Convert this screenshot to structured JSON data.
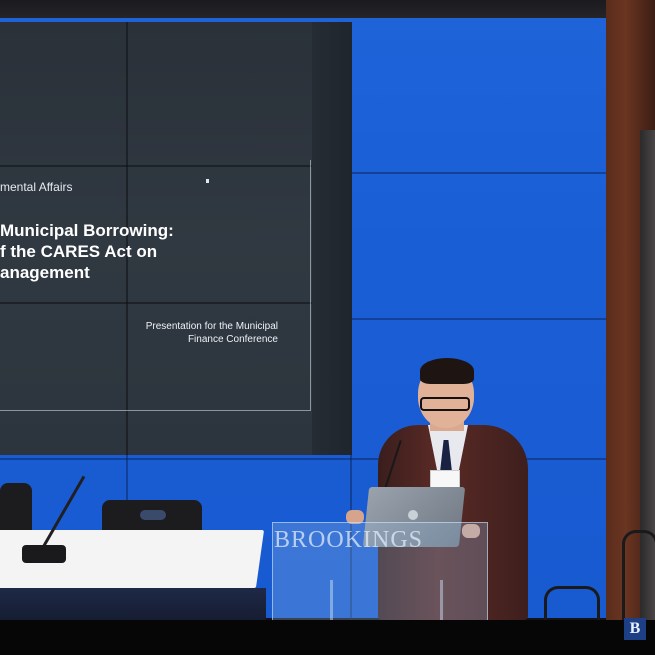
{
  "scene": {
    "description_hidden": ""
  },
  "slide": {
    "department": "mental Affairs",
    "title_lines": "Municipal Borrowing:\nf the CARES Act on\nanagement",
    "subtitle": "Presentation for the Municipal Finance Conference"
  },
  "podium": {
    "text": "BROOKINGS"
  },
  "logo": {
    "letter": "B"
  },
  "colors": {
    "wall_blue": "#1e63d8",
    "slide_dark": "#2f3740",
    "logo_blue": "#1d3f86"
  }
}
